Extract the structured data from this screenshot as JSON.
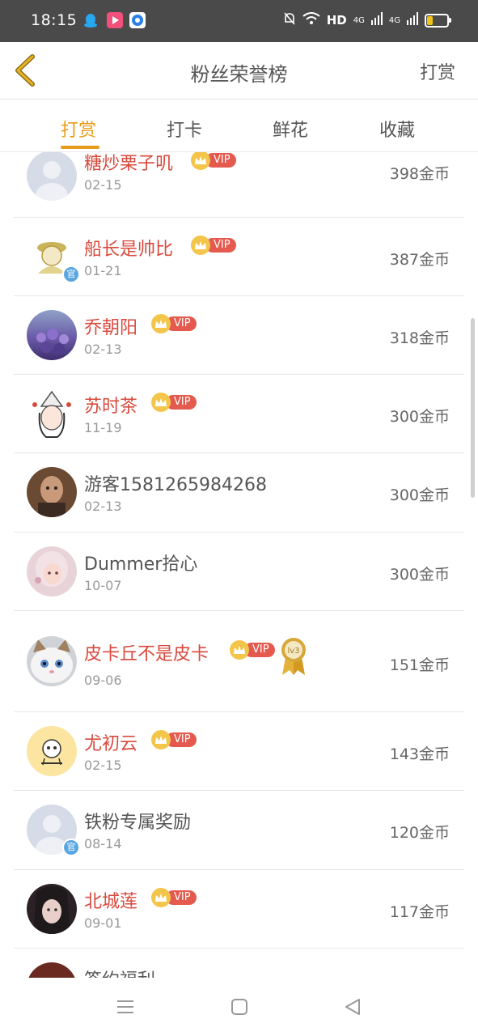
{
  "status_bar": {
    "time": "18:15",
    "network": "HD",
    "signal_a": "4G",
    "signal_b": "4G",
    "battery_level": 0.25
  },
  "header": {
    "title": "粉丝荣誉榜",
    "action": "打赏"
  },
  "tabs": [
    {
      "label": "打赏",
      "active": true
    },
    {
      "label": "打卡",
      "active": false
    },
    {
      "label": "鲜花",
      "active": false
    },
    {
      "label": "收藏",
      "active": false
    }
  ],
  "vip_label": "VIP",
  "official_label": "官",
  "medal_label": "lv3",
  "rows": [
    {
      "name": "糖炒栗子叽",
      "date": "02-15",
      "amount": "398金币",
      "vip": true
    },
    {
      "name": "船长是帅比",
      "date": "01-21",
      "amount": "387金币",
      "vip": true,
      "official": true
    },
    {
      "name": "乔朝阳",
      "date": "02-13",
      "amount": "318金币",
      "vip": true
    },
    {
      "name": "苏时茶",
      "date": "11-19",
      "amount": "300金币",
      "vip": true
    },
    {
      "name": "游客1581265984268",
      "date": "02-13",
      "amount": "300金币",
      "vip": false
    },
    {
      "name": "Dummer拾心",
      "date": "10-07",
      "amount": "300金币",
      "vip": false
    },
    {
      "name": "皮卡丘不是皮卡",
      "date": "09-06",
      "amount": "151金币",
      "vip": true,
      "medal": true
    },
    {
      "name": "尤初云",
      "date": "02-15",
      "amount": "143金币",
      "vip": true
    },
    {
      "name": "铁粉专属奖励",
      "date": "08-14",
      "amount": "120金币",
      "vip": false,
      "official": true
    },
    {
      "name": "北城莲",
      "date": "09-01",
      "amount": "117金币",
      "vip": true
    },
    {
      "name": "签约福利",
      "date": "",
      "amount": "",
      "vip": false
    }
  ],
  "colors": {
    "accent": "#e89b1a",
    "vip_name": "#d94a3d",
    "vip_tag": "#e45a4e",
    "status_bar": "#4a4a4a"
  }
}
